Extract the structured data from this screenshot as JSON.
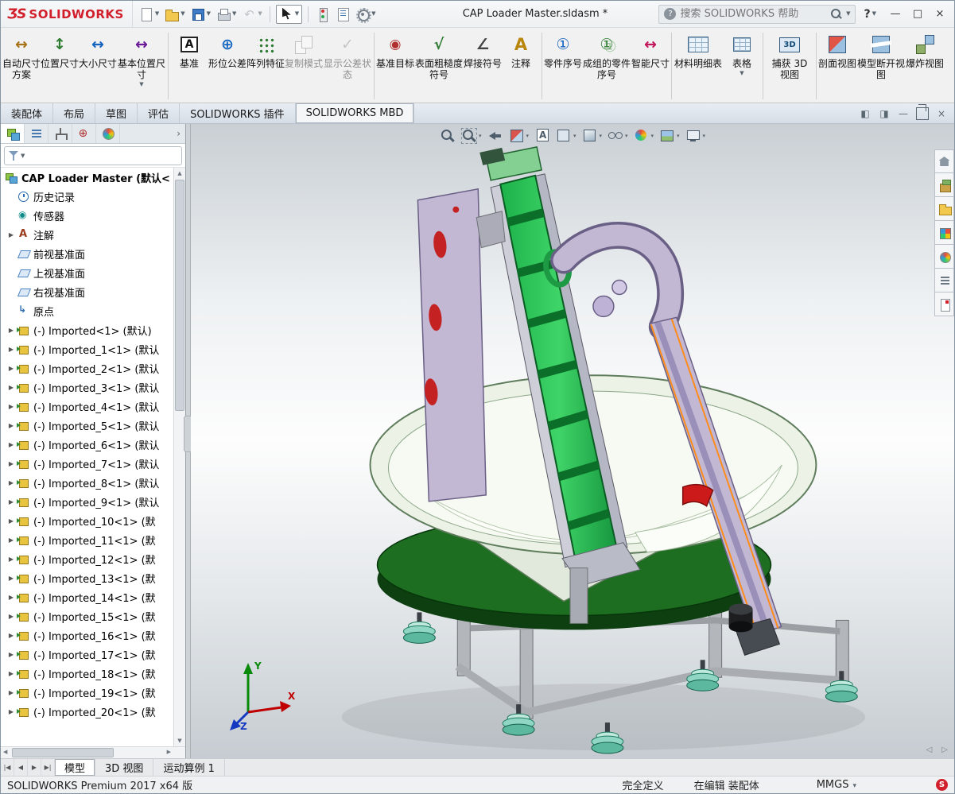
{
  "window": {
    "brand": "SOLIDWORKS",
    "logo_mark": "ƷS",
    "doc_title": "CAP Loader Master.sldasm *",
    "search_placeholder": "搜索 SOLIDWORKS 帮助",
    "search_help_glyph": "?",
    "help_label": "?",
    "controls": {
      "minimize": "—",
      "maximize": "□",
      "close": "×"
    },
    "doc_controls": [
      {
        "id": "pane-left",
        "glyph": "◧"
      },
      {
        "id": "pane-right",
        "glyph": "◨"
      },
      {
        "id": "doc-minimize",
        "glyph": "—"
      },
      {
        "id": "doc-restore",
        "glyph": ""
      },
      {
        "id": "doc-close",
        "glyph": "×"
      }
    ]
  },
  "qat": [
    {
      "id": "new-document",
      "caret": true
    },
    {
      "id": "open",
      "caret": true
    },
    {
      "id": "save",
      "caret": true
    },
    {
      "id": "print",
      "caret": true
    },
    {
      "id": "undo",
      "caret": true,
      "disabled": true
    },
    {
      "sep": true
    },
    {
      "id": "select",
      "caret": true,
      "boxed": true
    },
    {
      "sep": true
    },
    {
      "id": "rebuild"
    },
    {
      "id": "file-properties"
    },
    {
      "id": "options",
      "caret": true
    }
  ],
  "ribbon": [
    {
      "id": "auto-dimension-scheme",
      "label": "自动尺寸方案"
    },
    {
      "id": "location-dimension",
      "label": "位置尺寸"
    },
    {
      "id": "size-dimension",
      "label": "大小尺寸"
    },
    {
      "id": "basic-location-dimension",
      "label": "基本位置尺寸",
      "caret": true,
      "wide": true
    },
    {
      "sep": true
    },
    {
      "id": "datum",
      "label": "基准"
    },
    {
      "id": "geometric-tolerance",
      "label": "形位公差"
    },
    {
      "id": "pattern-feature",
      "label": "阵列特征"
    },
    {
      "id": "copy-scheme",
      "label": "复制模式",
      "disabled": true
    },
    {
      "id": "tolerance-status",
      "label": "显示公差状态",
      "disabled": true,
      "wide": true
    },
    {
      "sep": true
    },
    {
      "id": "datum-target",
      "label": "基准目标"
    },
    {
      "id": "surface-finish",
      "label": "表面粗糙度符号",
      "wide": true
    },
    {
      "id": "weld-symbol",
      "label": "焊接符号"
    },
    {
      "id": "note",
      "label": "注释"
    },
    {
      "sep": true
    },
    {
      "id": "balloon",
      "label": "零件序号"
    },
    {
      "id": "auto-balloon",
      "label": "成组的零件序号",
      "wide": true
    },
    {
      "id": "smart-dimension",
      "label": "智能尺寸"
    },
    {
      "sep": true
    },
    {
      "id": "bill-of-materials",
      "label": "材料明细表",
      "wide": true
    },
    {
      "id": "tables",
      "label": "表格",
      "caret": true
    },
    {
      "sep": true
    },
    {
      "id": "capture-3d-view",
      "label": "捕获 3D 视图",
      "wide": true
    },
    {
      "sep": true
    },
    {
      "id": "section-view",
      "label": "剖面视图"
    },
    {
      "id": "model-break-view",
      "label": "模型断开视图",
      "wide": true
    },
    {
      "id": "exploded-view",
      "label": "爆炸视图"
    }
  ],
  "command_tabs": [
    {
      "label": "装配体"
    },
    {
      "label": "布局"
    },
    {
      "label": "草图"
    },
    {
      "label": "评估"
    },
    {
      "label": "SOLIDWORKS 插件"
    },
    {
      "label": "SOLIDWORKS MBD",
      "active": true
    }
  ],
  "panel": {
    "tabs": [
      {
        "id": "featuremanager",
        "active": true
      },
      {
        "id": "propertymanager"
      },
      {
        "id": "configurationmanager"
      },
      {
        "id": "dimxpertmanager"
      },
      {
        "id": "displaymanager"
      }
    ],
    "expand_arrow": "›"
  },
  "tree": {
    "root": {
      "label": "CAP Loader Master (默认<"
    },
    "items": [
      {
        "icon": "history",
        "label": "历史记录"
      },
      {
        "icon": "sensors",
        "label": "传感器"
      },
      {
        "icon": "annotations",
        "label": "注解",
        "caret": true
      },
      {
        "icon": "plane",
        "label": "前视基准面"
      },
      {
        "icon": "plane",
        "label": "上视基准面"
      },
      {
        "icon": "plane",
        "label": "右视基准面"
      },
      {
        "icon": "origin",
        "label": "原点"
      },
      {
        "icon": "part",
        "label": "(-) Imported<1> (默认)",
        "caret": true
      },
      {
        "icon": "part",
        "label": "(-) Imported_1<1> (默认",
        "caret": true
      },
      {
        "icon": "part",
        "label": "(-) Imported_2<1> (默认",
        "caret": true
      },
      {
        "icon": "part",
        "label": "(-) Imported_3<1> (默认",
        "caret": true
      },
      {
        "icon": "part",
        "label": "(-) Imported_4<1> (默认",
        "caret": true
      },
      {
        "icon": "part",
        "label": "(-) Imported_5<1> (默认",
        "caret": true
      },
      {
        "icon": "part",
        "label": "(-) Imported_6<1> (默认",
        "caret": true
      },
      {
        "icon": "part",
        "label": "(-) Imported_7<1> (默认",
        "caret": true
      },
      {
        "icon": "part",
        "label": "(-) Imported_8<1> (默认",
        "caret": true
      },
      {
        "icon": "part",
        "label": "(-) Imported_9<1> (默认",
        "caret": true
      },
      {
        "icon": "part",
        "label": "(-) Imported_10<1> (默",
        "caret": true
      },
      {
        "icon": "part",
        "label": "(-) Imported_11<1> (默",
        "caret": true
      },
      {
        "icon": "part",
        "label": "(-) Imported_12<1> (默",
        "caret": true
      },
      {
        "icon": "part",
        "label": "(-) Imported_13<1> (默",
        "caret": true
      },
      {
        "icon": "part",
        "label": "(-) Imported_14<1> (默",
        "caret": true
      },
      {
        "icon": "part",
        "label": "(-) Imported_15<1> (默",
        "caret": true
      },
      {
        "icon": "part",
        "label": "(-) Imported_16<1> (默",
        "caret": true
      },
      {
        "icon": "part",
        "label": "(-) Imported_17<1> (默",
        "caret": true
      },
      {
        "icon": "part",
        "label": "(-) Imported_18<1> (默",
        "caret": true
      },
      {
        "icon": "part",
        "label": "(-) Imported_19<1> (默",
        "caret": true
      },
      {
        "icon": "part",
        "label": "(-) Imported_20<1> (默",
        "caret": true
      }
    ],
    "scroll_up": "▲",
    "scroll_down": "▼",
    "scroll_left": "◀",
    "scroll_right": "▶"
  },
  "headsup": [
    {
      "id": "zoom-fit"
    },
    {
      "id": "zoom-area",
      "caret": true
    },
    {
      "id": "previous-view"
    },
    {
      "id": "section-view",
      "caret": true
    },
    {
      "id": "dynamic-annotation-views"
    },
    {
      "id": "view-orientation",
      "caret": true
    },
    {
      "id": "display-style",
      "caret": true
    },
    {
      "id": "hide-show-items",
      "caret": true
    },
    {
      "id": "edit-appearance",
      "caret": true
    },
    {
      "id": "apply-scene",
      "caret": true
    },
    {
      "id": "view-settings",
      "caret": true
    }
  ],
  "task_pane": [
    {
      "id": "home"
    },
    {
      "id": "design-library"
    },
    {
      "id": "file-explorer"
    },
    {
      "id": "view-palette"
    },
    {
      "id": "appearances-scenes"
    },
    {
      "id": "custom-properties"
    },
    {
      "id": "solidworks-resources"
    }
  ],
  "viewport": {
    "triad": {
      "x": "X",
      "y": "Y",
      "z": "Z"
    },
    "nav": [
      "◁",
      "▷"
    ]
  },
  "bottom_tabs": {
    "nav": [
      "|◀",
      "◀",
      "▶",
      "▶|"
    ],
    "tabs": [
      {
        "label": "模型",
        "active": true
      },
      {
        "label": "3D 视图"
      },
      {
        "label": "运动算例 1"
      }
    ]
  },
  "status_bar": {
    "product": "SOLIDWORKS Premium 2017 x64 版",
    "define_status": "完全定义",
    "edit_status": "在编辑 装配体",
    "units": "MMGS",
    "logo_glyph": "S"
  }
}
